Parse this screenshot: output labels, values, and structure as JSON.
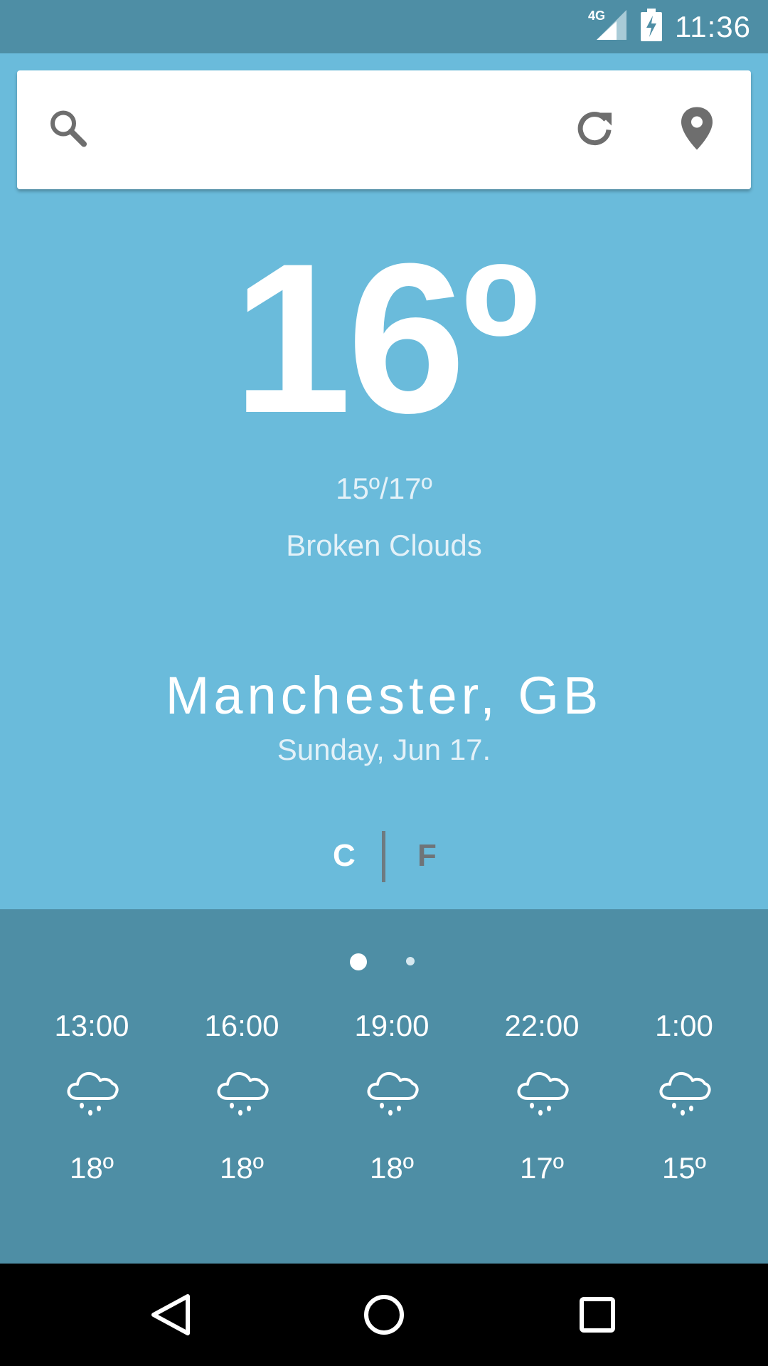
{
  "status_bar": {
    "network": "4G",
    "time": "11:36",
    "icons": [
      "signal-icon",
      "battery-charging-icon"
    ]
  },
  "search": {
    "placeholder": "",
    "icons": [
      "search-icon",
      "refresh-icon",
      "location-icon"
    ]
  },
  "current": {
    "temperature": "16º",
    "min_max": "15º/17º",
    "condition": "Broken Clouds"
  },
  "location": {
    "city": "Manchester, GB",
    "date": "Sunday, Jun 17."
  },
  "units": {
    "celsius": "C",
    "fahrenheit": "F",
    "selected": "C"
  },
  "pager": {
    "pages": 2,
    "active_index": 0
  },
  "forecast": [
    {
      "time": "13:00",
      "icon": "rain-cloud-icon",
      "temp": "18º"
    },
    {
      "time": "16:00",
      "icon": "rain-cloud-icon",
      "temp": "18º"
    },
    {
      "time": "19:00",
      "icon": "rain-cloud-icon",
      "temp": "18º"
    },
    {
      "time": "22:00",
      "icon": "rain-cloud-icon",
      "temp": "17º"
    },
    {
      "time": "1:00",
      "icon": "rain-cloud-icon",
      "temp": "15º"
    }
  ],
  "nav_bar": {
    "icons": [
      "back-icon",
      "home-icon",
      "recents-icon"
    ]
  },
  "colors": {
    "sky": "#6abbdb",
    "panel": "#4e8ea5",
    "status_bar": "#4e8ea5",
    "icon_gray": "#6e6e6e"
  }
}
